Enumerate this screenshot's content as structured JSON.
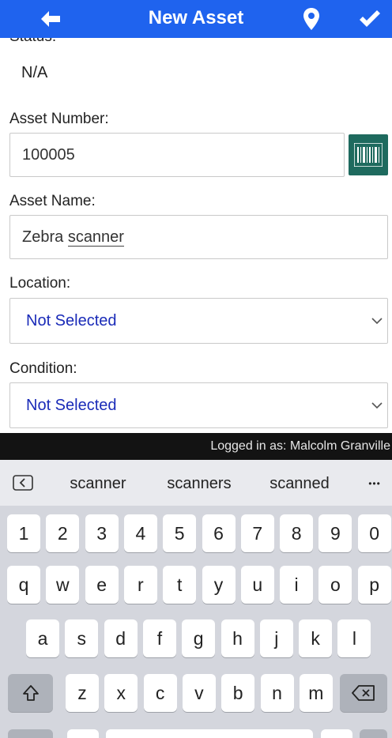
{
  "header": {
    "title": "New Asset",
    "color": "#1f63ee"
  },
  "form": {
    "status_label_cut": "Status:",
    "status_value": "N/A",
    "asset_number_label": "Asset Number:",
    "asset_number_value": "100005",
    "asset_name_label": "Asset Name:",
    "asset_name_value_prefix": "Zebra ",
    "asset_name_value_word": "scanner",
    "location_label": "Location:",
    "location_value": "Not Selected",
    "condition_label": "Condition:",
    "condition_value": "Not Selected"
  },
  "status_bar": {
    "logged_in_text": "Logged in as: Malcolm Granville"
  },
  "keyboard": {
    "suggestions": [
      "scanner",
      "scanners",
      "scanned"
    ],
    "more": "•••",
    "row_numbers": [
      "1",
      "2",
      "3",
      "4",
      "5",
      "6",
      "7",
      "8",
      "9",
      "0"
    ],
    "row_top": [
      "q",
      "w",
      "e",
      "r",
      "t",
      "y",
      "u",
      "i",
      "o",
      "p"
    ],
    "row_mid": [
      "a",
      "s",
      "d",
      "f",
      "g",
      "h",
      "j",
      "k",
      "l"
    ],
    "row_bottom": [
      "z",
      "x",
      "c",
      "v",
      "b",
      "n",
      "m"
    ]
  },
  "icons": {
    "back": "back-arrow-icon",
    "pin": "map-pin-icon",
    "check": "check-icon",
    "barcode": "barcode-icon",
    "shift": "shift-icon",
    "backspace": "backspace-icon",
    "suggest_back": "suggestion-back-icon"
  }
}
